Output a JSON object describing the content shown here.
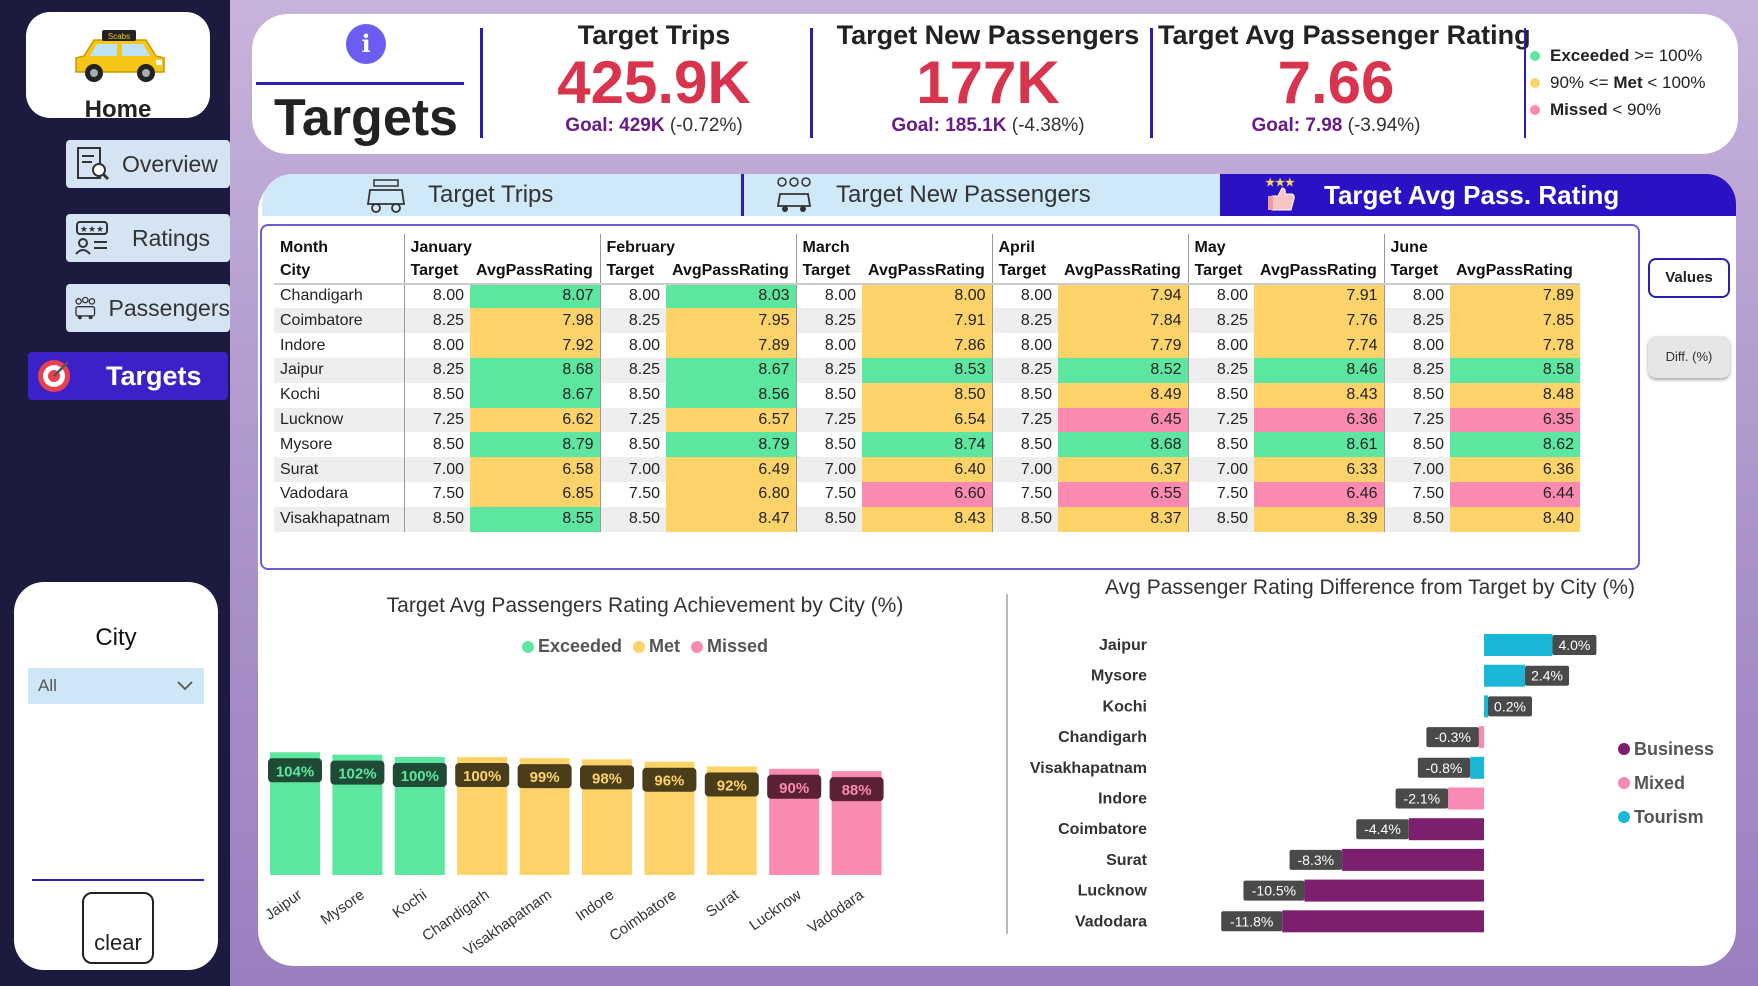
{
  "sidebar": {
    "home_label": "Home",
    "nav": [
      {
        "label": "Overview"
      },
      {
        "label": "Ratings"
      },
      {
        "label": "Passengers"
      },
      {
        "label": "Targets",
        "active": true
      }
    ],
    "logo_text": "Scabs"
  },
  "filter": {
    "title": "City",
    "selected": "All",
    "clear_label": "clear"
  },
  "header": {
    "title": "Targets",
    "info_icon": "i",
    "kpis": [
      {
        "title": "Target Trips",
        "value": "425.9K",
        "goal_label": "Goal:",
        "goal_value": "429K",
        "goal_diff": "(-0.72%)"
      },
      {
        "title": "Target New Passengers",
        "value": "177K",
        "goal_label": "Goal:",
        "goal_value": "185.1K",
        "goal_diff": "(-4.38%)"
      },
      {
        "title": "Target Avg Passenger Rating",
        "value": "7.66",
        "goal_label": "Goal:",
        "goal_value": "7.98",
        "goal_diff": "(-3.94%)"
      }
    ],
    "legend": [
      {
        "name": "Exceeded",
        "rule": ">= 100%",
        "color": "#5de6a0"
      },
      {
        "name": "Met",
        "prefix": "90% <=",
        "rule": "< 100%",
        "color": "#fdd36a"
      },
      {
        "name": "Missed",
        "rule": "< 90%",
        "color": "#fb8ab0"
      }
    ]
  },
  "tabs": [
    {
      "label": "Target Trips"
    },
    {
      "label": "Target New Passengers"
    },
    {
      "label": "Target Avg Pass. Rating",
      "active": true
    }
  ],
  "matrix": {
    "row_header_top": "Month",
    "row_header": "City",
    "months": [
      "January",
      "February",
      "March",
      "April",
      "May",
      "June"
    ],
    "col_target": "Target",
    "col_value": "AvgPassRating",
    "rows": [
      {
        "city": "Chandigarh",
        "cells": [
          [
            "8.00",
            "8.07",
            "e"
          ],
          [
            "8.00",
            "8.03",
            "e"
          ],
          [
            "8.00",
            "8.00",
            "m"
          ],
          [
            "8.00",
            "7.94",
            "m"
          ],
          [
            "8.00",
            "7.91",
            "m"
          ],
          [
            "8.00",
            "7.89",
            "m"
          ]
        ]
      },
      {
        "city": "Coimbatore",
        "cells": [
          [
            "8.25",
            "7.98",
            "m"
          ],
          [
            "8.25",
            "7.95",
            "m"
          ],
          [
            "8.25",
            "7.91",
            "m"
          ],
          [
            "8.25",
            "7.84",
            "m"
          ],
          [
            "8.25",
            "7.76",
            "m"
          ],
          [
            "8.25",
            "7.85",
            "m"
          ]
        ]
      },
      {
        "city": "Indore",
        "cells": [
          [
            "8.00",
            "7.92",
            "m"
          ],
          [
            "8.00",
            "7.89",
            "m"
          ],
          [
            "8.00",
            "7.86",
            "m"
          ],
          [
            "8.00",
            "7.79",
            "m"
          ],
          [
            "8.00",
            "7.74",
            "m"
          ],
          [
            "8.00",
            "7.78",
            "m"
          ]
        ]
      },
      {
        "city": "Jaipur",
        "cells": [
          [
            "8.25",
            "8.68",
            "e"
          ],
          [
            "8.25",
            "8.67",
            "e"
          ],
          [
            "8.25",
            "8.53",
            "e"
          ],
          [
            "8.25",
            "8.52",
            "e"
          ],
          [
            "8.25",
            "8.46",
            "e"
          ],
          [
            "8.25",
            "8.58",
            "e"
          ]
        ]
      },
      {
        "city": "Kochi",
        "cells": [
          [
            "8.50",
            "8.67",
            "e"
          ],
          [
            "8.50",
            "8.56",
            "e"
          ],
          [
            "8.50",
            "8.50",
            "m"
          ],
          [
            "8.50",
            "8.49",
            "m"
          ],
          [
            "8.50",
            "8.43",
            "m"
          ],
          [
            "8.50",
            "8.48",
            "m"
          ]
        ]
      },
      {
        "city": "Lucknow",
        "cells": [
          [
            "7.25",
            "6.62",
            "m"
          ],
          [
            "7.25",
            "6.57",
            "m"
          ],
          [
            "7.25",
            "6.54",
            "m"
          ],
          [
            "7.25",
            "6.45",
            "x"
          ],
          [
            "7.25",
            "6.36",
            "x"
          ],
          [
            "7.25",
            "6.35",
            "x"
          ]
        ]
      },
      {
        "city": "Mysore",
        "cells": [
          [
            "8.50",
            "8.79",
            "e"
          ],
          [
            "8.50",
            "8.79",
            "e"
          ],
          [
            "8.50",
            "8.74",
            "e"
          ],
          [
            "8.50",
            "8.68",
            "e"
          ],
          [
            "8.50",
            "8.61",
            "e"
          ],
          [
            "8.50",
            "8.62",
            "e"
          ]
        ]
      },
      {
        "city": "Surat",
        "cells": [
          [
            "7.00",
            "6.58",
            "m"
          ],
          [
            "7.00",
            "6.49",
            "m"
          ],
          [
            "7.00",
            "6.40",
            "m"
          ],
          [
            "7.00",
            "6.37",
            "m"
          ],
          [
            "7.00",
            "6.33",
            "m"
          ],
          [
            "7.00",
            "6.36",
            "m"
          ]
        ]
      },
      {
        "city": "Vadodara",
        "cells": [
          [
            "7.50",
            "6.85",
            "m"
          ],
          [
            "7.50",
            "6.80",
            "m"
          ],
          [
            "7.50",
            "6.60",
            "x"
          ],
          [
            "7.50",
            "6.55",
            "x"
          ],
          [
            "7.50",
            "6.46",
            "x"
          ],
          [
            "7.50",
            "6.44",
            "x"
          ]
        ]
      },
      {
        "city": "Visakhapatnam",
        "cells": [
          [
            "8.50",
            "8.55",
            "e"
          ],
          [
            "8.50",
            "8.47",
            "m"
          ],
          [
            "8.50",
            "8.43",
            "m"
          ],
          [
            "8.50",
            "8.37",
            "m"
          ],
          [
            "8.50",
            "8.39",
            "m"
          ],
          [
            "8.50",
            "8.40",
            "m"
          ]
        ]
      }
    ]
  },
  "buttons": {
    "values": "Values",
    "diff": "Diff. (%)"
  },
  "colors": {
    "exceeded": "#5de6a0",
    "met": "#fdd36a",
    "missed": "#fb8ab0",
    "business": "#7b1f6e",
    "mixed": "#f98ab6",
    "tourism": "#1ab8d6",
    "accent": "#2a12c4",
    "kpi_value": "#d8344e"
  },
  "chart_data": [
    {
      "type": "bar",
      "title": "Target Avg Passengers Rating Achievement by City (%)",
      "legend": [
        "Exceeded",
        "Met",
        "Missed"
      ],
      "categories": [
        "Jaipur",
        "Mysore",
        "Kochi",
        "Chandigarh",
        "Visakhapatnam",
        "Indore",
        "Coimbatore",
        "Surat",
        "Lucknow",
        "Vadodara"
      ],
      "values": [
        104,
        102,
        100,
        100,
        99,
        98,
        96,
        92,
        90,
        88
      ],
      "status": [
        "Exceeded",
        "Exceeded",
        "Exceeded",
        "Met",
        "Met",
        "Met",
        "Met",
        "Met",
        "Missed",
        "Missed"
      ],
      "labels": [
        "104%",
        "102%",
        "100%",
        "100%",
        "99%",
        "98%",
        "96%",
        "92%",
        "90%",
        "88%"
      ]
    },
    {
      "type": "bar",
      "orientation": "horizontal",
      "title": "Avg Passenger Rating Difference from Target by City (%)",
      "legend": [
        "Business",
        "Mixed",
        "Tourism"
      ],
      "categories": [
        "Jaipur",
        "Mysore",
        "Kochi",
        "Chandigarh",
        "Visakhapatnam",
        "Indore",
        "Coimbatore",
        "Surat",
        "Lucknow",
        "Vadodara"
      ],
      "values": [
        4.0,
        2.4,
        0.2,
        -0.3,
        -0.8,
        -2.1,
        -4.4,
        -8.3,
        -10.5,
        -11.8
      ],
      "labels": [
        "4.0%",
        "2.4%",
        "0.2%",
        "-0.3%",
        "-0.8%",
        "-2.1%",
        "-4.4%",
        "-8.3%",
        "-10.5%",
        "-11.8%"
      ],
      "city_type": [
        "Tourism",
        "Tourism",
        "Tourism",
        "Mixed",
        "Tourism",
        "Mixed",
        "Business",
        "Business",
        "Business",
        "Business"
      ]
    }
  ]
}
